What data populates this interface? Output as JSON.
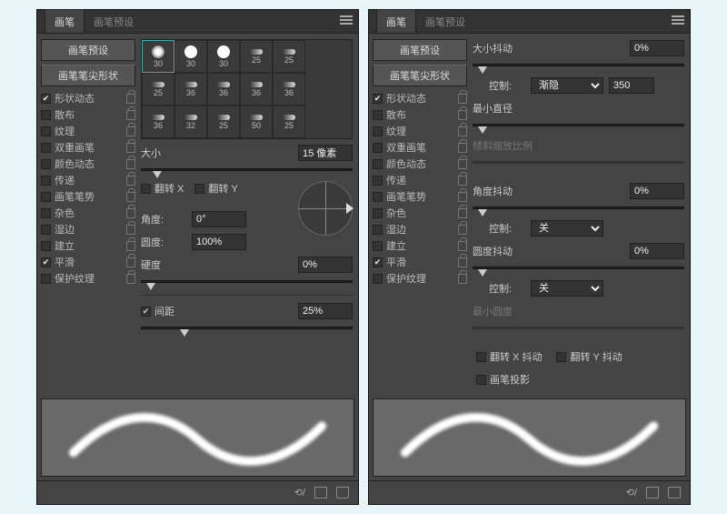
{
  "leftPanel": {
    "tabs": [
      "画笔",
      "画笔预设"
    ],
    "activeTab": 0,
    "presetButton": "画笔预设",
    "tipButton": "画笔笔尖形状",
    "options": [
      {
        "label": "形状动态",
        "checked": true
      },
      {
        "label": "散布",
        "checked": false
      },
      {
        "label": "纹理",
        "checked": false
      },
      {
        "label": "双重画笔",
        "checked": false
      },
      {
        "label": "颜色动态",
        "checked": false
      },
      {
        "label": "传递",
        "checked": false
      },
      {
        "label": "画笔笔势",
        "checked": false
      },
      {
        "label": "杂色",
        "checked": false
      },
      {
        "label": "湿边",
        "checked": false
      },
      {
        "label": "建立",
        "checked": false
      },
      {
        "label": "平滑",
        "checked": true
      },
      {
        "label": "保护纹理",
        "checked": false
      }
    ],
    "brushes": [
      {
        "v": "30",
        "sel": true,
        "t": "soft"
      },
      {
        "v": "30",
        "t": "hard"
      },
      {
        "v": "30",
        "t": "hard"
      },
      {
        "v": "25",
        "t": "tri"
      },
      {
        "v": "25",
        "t": "tri"
      },
      {
        "v": "25",
        "t": "tri"
      },
      {
        "v": "36",
        "t": "tri"
      },
      {
        "v": "36",
        "t": "tri"
      },
      {
        "v": "36",
        "t": "tri"
      },
      {
        "v": "36",
        "t": "tri"
      },
      {
        "v": "36",
        "t": "tri"
      },
      {
        "v": "32",
        "t": "tri"
      },
      {
        "v": "25",
        "t": "tri"
      },
      {
        "v": "50",
        "t": "tri"
      },
      {
        "v": "25",
        "t": "tri"
      }
    ],
    "size": {
      "label": "大小",
      "value": "15 像素",
      "pos": 5
    },
    "flipX": {
      "label": "翻转 X",
      "checked": false
    },
    "flipY": {
      "label": "翻转 Y",
      "checked": false
    },
    "angle": {
      "label": "角度:",
      "value": "0°"
    },
    "round": {
      "label": "圆度:",
      "value": "100%"
    },
    "hard": {
      "label": "硬度",
      "value": "0%",
      "pos": 2
    },
    "spacing": {
      "label": "间距",
      "checked": true,
      "value": "25%",
      "pos": 18
    }
  },
  "rightPanel": {
    "tabs": [
      "画笔",
      "画笔预设"
    ],
    "activeTab": 0,
    "presetButton": "画笔预设",
    "tipButton": "画笔笔尖形状",
    "options": [
      {
        "label": "形状动态",
        "checked": true
      },
      {
        "label": "散布",
        "checked": false
      },
      {
        "label": "纹理",
        "checked": false
      },
      {
        "label": "双重画笔",
        "checked": false
      },
      {
        "label": "颜色动态",
        "checked": false
      },
      {
        "label": "传递",
        "checked": false
      },
      {
        "label": "画笔笔势",
        "checked": false
      },
      {
        "label": "杂色",
        "checked": false
      },
      {
        "label": "湿边",
        "checked": false
      },
      {
        "label": "建立",
        "checked": false
      },
      {
        "label": "平滑",
        "checked": true
      },
      {
        "label": "保护纹理",
        "checked": false
      }
    ],
    "sizeJitter": {
      "label": "大小抖动",
      "value": "0%",
      "pos": 2
    },
    "control1": {
      "label": "控制:",
      "select": "渐隐",
      "value": "350"
    },
    "minDiam": {
      "label": "最小直径",
      "value": "",
      "pos": 2
    },
    "tiltScale": {
      "label": "倾斜缩放比例"
    },
    "angleJitter": {
      "label": "角度抖动",
      "value": "0%",
      "pos": 2
    },
    "control2": {
      "label": "控制:",
      "select": "关"
    },
    "roundJitter": {
      "label": "圆度抖动",
      "value": "0%",
      "pos": 2
    },
    "control3": {
      "label": "控制:",
      "select": "关"
    },
    "minRound": {
      "label": "最小圆度"
    },
    "flipXJitter": {
      "label": "翻转 X 抖动",
      "checked": false
    },
    "flipYJitter": {
      "label": "翻转 Y 抖动",
      "checked": false
    },
    "brushProj": {
      "label": "画笔投影",
      "checked": false
    }
  }
}
